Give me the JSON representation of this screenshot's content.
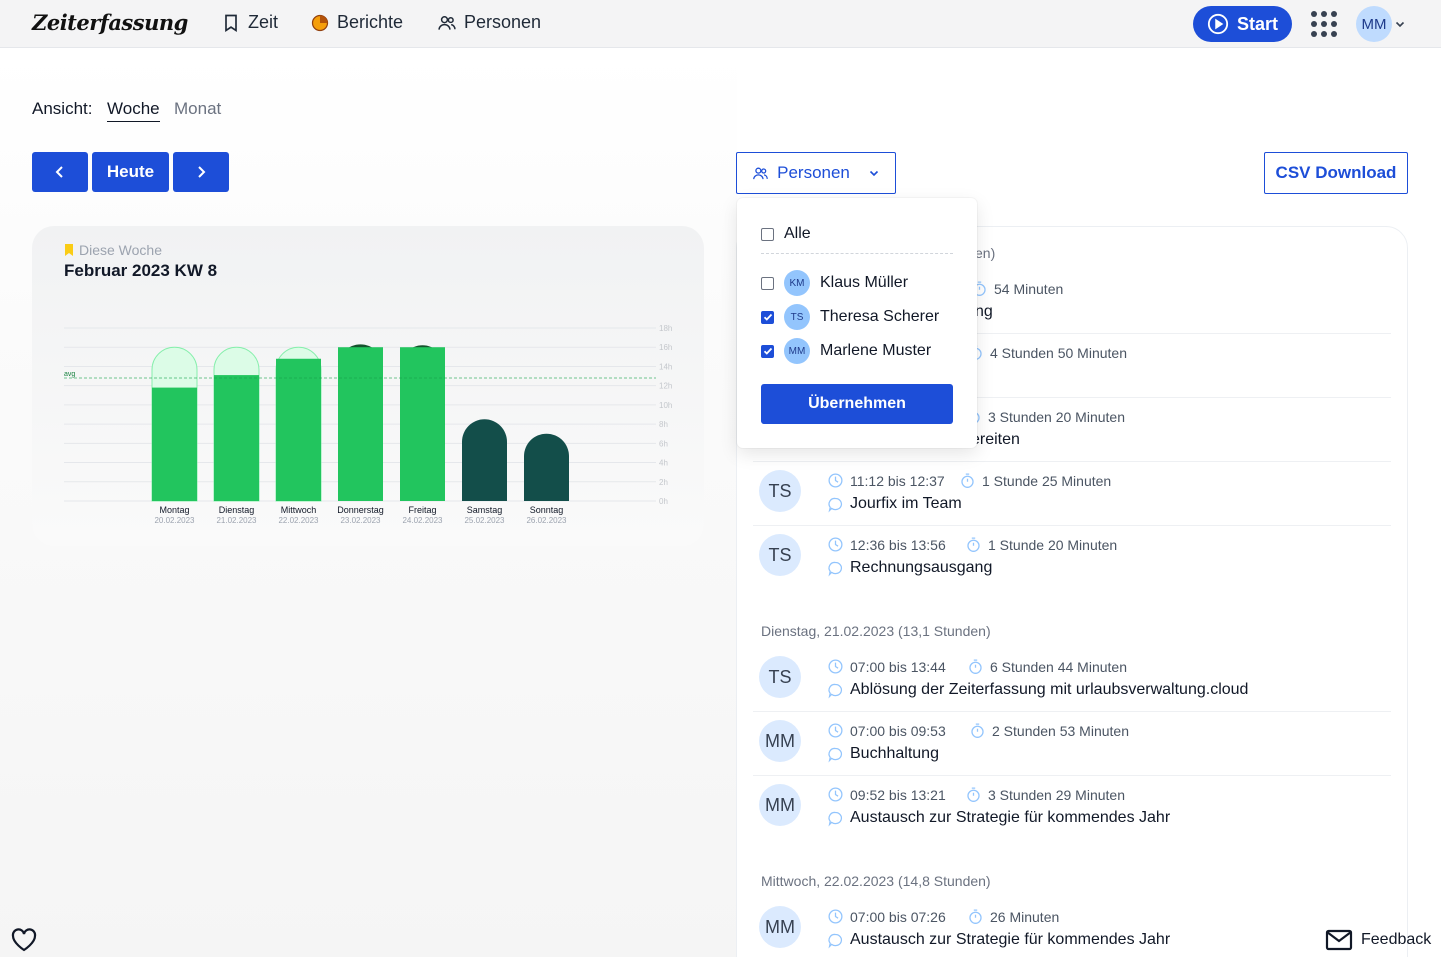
{
  "app": {
    "logo": "Zeiterfassung"
  },
  "nav": {
    "zeit": "Zeit",
    "berichte": "Berichte",
    "personen": "Personen",
    "start": "Start",
    "user_initials": "MM"
  },
  "view": {
    "label": "Ansicht:",
    "week": "Woche",
    "month": "Monat"
  },
  "controls": {
    "today": "Heute",
    "persons": "Personen",
    "csv": "CSV Download"
  },
  "chart_card": {
    "subtitle": "Diese Woche",
    "title": "Februar 2023 KW 8"
  },
  "chart_data": {
    "type": "bar",
    "categories": [
      "Montag",
      "Dienstag",
      "Mittwoch",
      "Donnerstag",
      "Freitag",
      "Samstag",
      "Sonntag"
    ],
    "dates": [
      "20.02.2023",
      "21.02.2023",
      "22.02.2023",
      "23.02.2023",
      "24.02.2023",
      "25.02.2023",
      "26.02.2023"
    ],
    "values": [
      11.8,
      13.1,
      14.8,
      16.3,
      16.2,
      8.5,
      7.0
    ],
    "target": [
      16,
      16,
      16,
      16,
      16,
      8.5,
      7.0
    ],
    "y_ticks": [
      "18h",
      "16h",
      "14h",
      "12h",
      "10h",
      "8h",
      "6h",
      "4h",
      "2h",
      "0h"
    ],
    "ylim": [
      0,
      18
    ],
    "avg": 12.8,
    "avg_label": "avg",
    "colors": {
      "bar": "#22c55e",
      "bar_light": "#4ade80",
      "target": "#dcfce7",
      "weekend": "#134e4a",
      "overtime": "#14532d"
    }
  },
  "dropdown": {
    "all_label": "Alle",
    "people": [
      {
        "initials": "KM",
        "name": "Klaus Müller",
        "checked": false
      },
      {
        "initials": "TS",
        "name": "Theresa Scherer",
        "checked": true
      },
      {
        "initials": "MM",
        "name": "Marlene Muster",
        "checked": true
      }
    ],
    "apply": "Übernehmen"
  },
  "list": {
    "first_day_suffix": "en)",
    "partial_entries": [
      {
        "duration": "54 Minuten",
        "desc_tail": "ng"
      },
      {
        "duration": "4 Stunden 50 Minuten"
      },
      {
        "duration": "3 Stunden 20 Minuten",
        "desc_tail": "ereiten"
      }
    ],
    "entries_day1": [
      {
        "initials": "TS",
        "time": "11:12 bis 12:37",
        "duration": "1 Stunde 25 Minuten",
        "desc": "Jourfix im Team"
      },
      {
        "initials": "TS",
        "time": "12:36 bis 13:56",
        "duration": "1 Stunde 20 Minuten",
        "desc": "Rechnungsausgang"
      }
    ],
    "day2_header": "Dienstag, 21.02.2023 (13,1 Stunden)",
    "entries_day2": [
      {
        "initials": "TS",
        "time": "07:00 bis 13:44",
        "duration": "6 Stunden 44 Minuten",
        "desc": "Ablösung der Zeiterfassung mit urlaubsverwaltung.cloud"
      },
      {
        "initials": "MM",
        "time": "07:00 bis 09:53",
        "duration": "2 Stunden 53 Minuten",
        "desc": "Buchhaltung"
      },
      {
        "initials": "MM",
        "time": "09:52 bis 13:21",
        "duration": "3 Stunden 29 Minuten",
        "desc": "Austausch zur Strategie für kommendes Jahr"
      }
    ],
    "day3_header": "Mittwoch, 22.02.2023 (14,8 Stunden)",
    "entries_day3": [
      {
        "initials": "MM",
        "time": "07:00 bis 07:26",
        "duration": "26 Minuten",
        "desc": "Austausch zur Strategie für kommendes Jahr"
      }
    ]
  },
  "footer": {
    "feedback": "Feedback"
  }
}
